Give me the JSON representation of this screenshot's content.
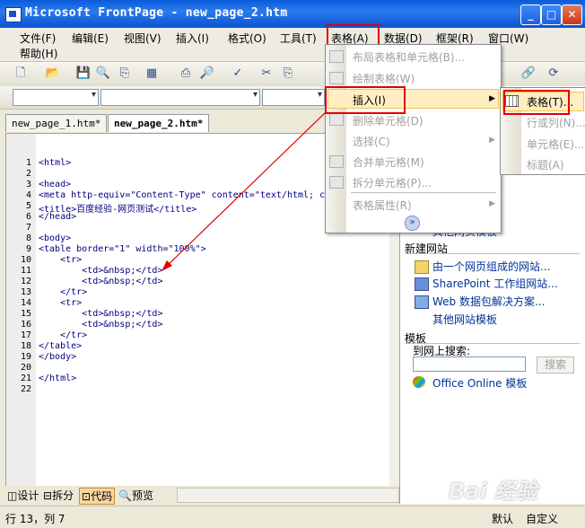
{
  "window": {
    "title": "Microsoft FrontPage - new_page_2.htm"
  },
  "menubar": {
    "items": [
      "文件(F)",
      "编辑(E)",
      "视图(V)",
      "插入(I)",
      "格式(O)",
      "工具(T)",
      "表格(A)",
      "数据(D)",
      "框架(R)",
      "窗口(W)"
    ],
    "help": "帮助(H)"
  },
  "tabs": [
    "new_page_1.htm*",
    "new_page_2.htm*"
  ],
  "tab_close": "✕",
  "code": {
    "line_numbers": [
      "1",
      "2",
      "3",
      "4",
      "5",
      "6",
      "7",
      "8",
      "9",
      "10",
      "11",
      "12",
      "13",
      "14",
      "15",
      "16",
      "17",
      "18",
      "19",
      "20",
      "21",
      "22"
    ],
    "lines": [
      "<html>",
      "",
      "<head>",
      "<meta http-equiv=\"Content-Type\" content=\"text/html; ch",
      "<title>百度经验-网页测试</title>",
      "</head>",
      "",
      "<body>",
      "<table border=\"1\" width=\"100%\">",
      "    <tr>",
      "        <td>&nbsp;</td>",
      "        <td>&nbsp;</td>",
      "    </tr>",
      "    <tr>",
      "        <td>&nbsp;</td>",
      "        <td>&nbsp;</td>",
      "    </tr>",
      "</table>",
      "</body>",
      "",
      "</html>",
      ""
    ]
  },
  "view_tabs": [
    "设计",
    "拆分",
    "代码",
    "预览"
  ],
  "status": {
    "position": "行 13，列 7",
    "mode": "默认",
    "custom": "自定义"
  },
  "table_menu": {
    "items": [
      {
        "label": "布局表格和单元格(B)...",
        "enabled": false
      },
      {
        "label": "绘制表格(W)",
        "enabled": false
      },
      {
        "label": "插入(I)",
        "enabled": true,
        "submenu": true
      },
      {
        "label": "删除单元格(D)",
        "enabled": false
      },
      {
        "label": "选择(C)",
        "enabled": false,
        "submenu": true
      },
      {
        "label": "合并单元格(M)",
        "enabled": false
      },
      {
        "label": "拆分单元格(P)...",
        "enabled": false
      },
      {
        "label": "表格属性(R)",
        "enabled": false,
        "submenu": true
      }
    ],
    "expand": "»"
  },
  "insert_submenu": {
    "items": [
      {
        "label": "表格(T)...",
        "enabled": true
      },
      {
        "label": "行或列(N)...",
        "enabled": false
      },
      {
        "label": "单元格(E)...",
        "enabled": false
      },
      {
        "label": "标题(A)",
        "enabled": false
      }
    ]
  },
  "task_pane": {
    "partial_link": "其他网页模板",
    "new_site_heading": "新建网站",
    "site_links": [
      "由一个网页组成的网站...",
      "SharePoint 工作组网站...",
      "Web 数据包解决方案...",
      "其他网站模板"
    ],
    "templates_heading": "模板",
    "search_label": "到网上搜索:",
    "search_value": "",
    "search_button": "搜索",
    "office_link": "Office Online 模板"
  },
  "watermark": "Bai 经验",
  "colors": {
    "highlight": "#FFEEC2",
    "annotation_red": "#E00000",
    "titlebar": "#0A5BD9"
  }
}
